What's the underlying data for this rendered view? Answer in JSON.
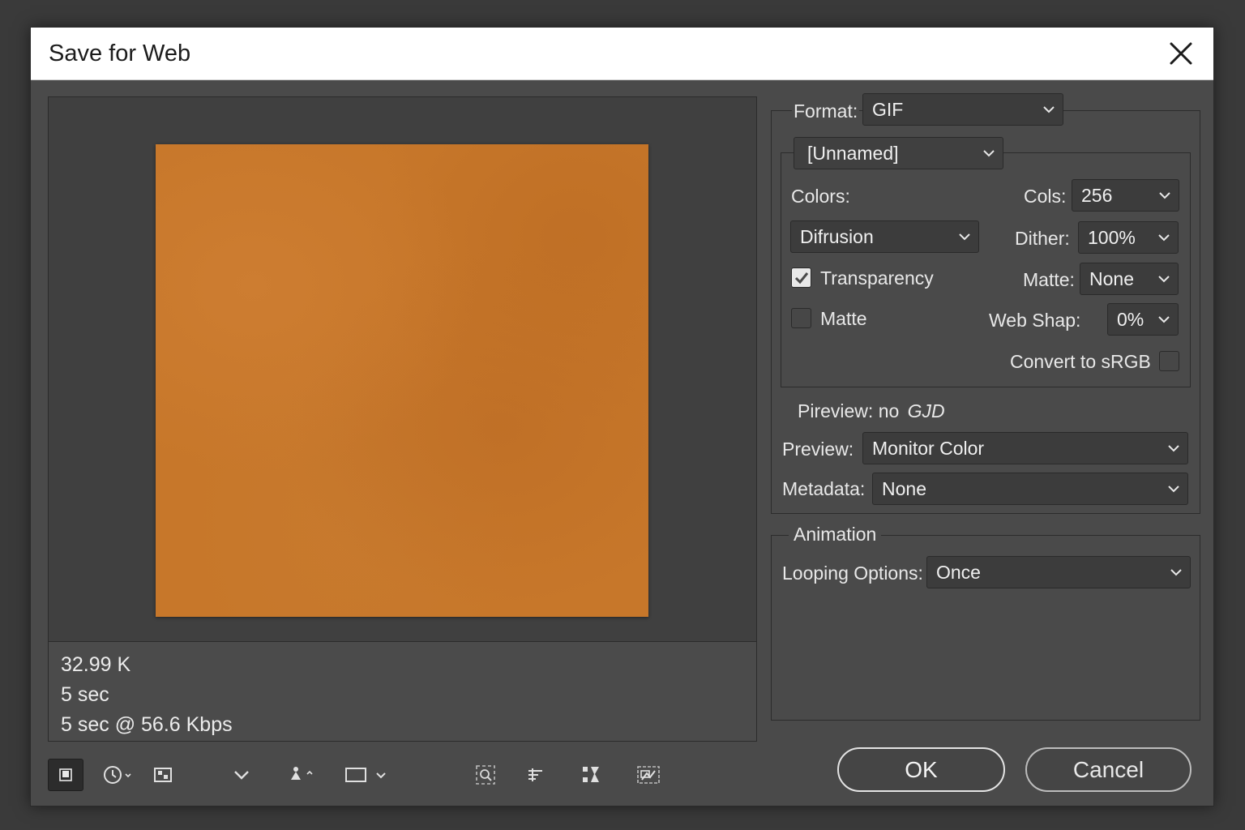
{
  "dialog": {
    "title": "Save for Web"
  },
  "preview_info": {
    "size": "32.99 K",
    "time1": "5 sec",
    "time2": "5 sec @ 56.6 Kbps"
  },
  "settings": {
    "format_label": "Format:",
    "format_value": "GIF",
    "preset_value": "[Unnamed]",
    "colors_label": "Colors:",
    "cols_label": "Cols:",
    "cols_value": "256",
    "reduction_value": "Difrusion",
    "dither_label": "Dither:",
    "dither_value": "100%",
    "transparency_label": "Transparency",
    "transparency_checked": true,
    "matte_check_label": "Matte",
    "matte_checked": false,
    "matte_label": "Matte:",
    "matte_value": "None",
    "webshap_label": "Web Shap:",
    "webshap_value": "0%",
    "convert_label": "Convert to sRGB",
    "convert_checked": false,
    "pireview_text": "Pireview: no",
    "pireview_glyph": "GJD",
    "preview_label": "Preview:",
    "preview_value": "Monitor Color",
    "metadata_label": "Metadata:",
    "metadata_value": "None"
  },
  "animation": {
    "legend": "Animation",
    "looping_label": "Looping Options:",
    "looping_value": "Once"
  },
  "buttons": {
    "ok": "OK",
    "cancel": "Cancel"
  },
  "toolbar_icons": [
    "preview-toggle-icon",
    "clock-icon",
    "palette-icon",
    "chevron-down-icon",
    "eyedropper-icon",
    "frame-icon",
    "zoom-icon",
    "align-icon",
    "slice-icon",
    "browser-preview-icon"
  ],
  "colors": {
    "image": "#c7772a",
    "dialog_bg": "#4a4a4a",
    "titlebar": "#ffffff"
  }
}
